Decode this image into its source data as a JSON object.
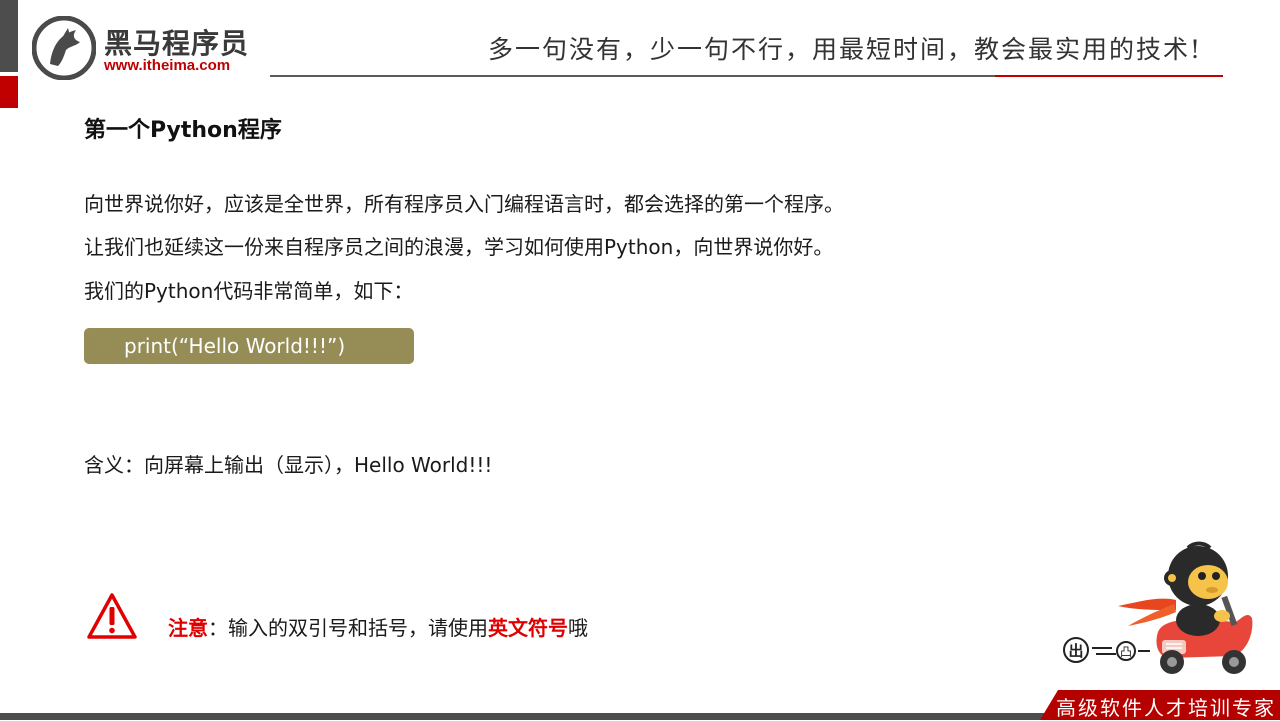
{
  "header": {
    "logo_name": "黑马程序员",
    "logo_url": "www.itheima.com",
    "slogan": "多一句没有，少一句不行，用最短时间，教会最实用的技术!"
  },
  "content": {
    "title": "第一个Python程序",
    "paragraphs": [
      "向世界说你好，应该是全世界，所有程序员入门编程语言时，都会选择的第一个程序。",
      "让我们也延续这一份来自程序员之间的浪漫，学习如何使用Python，向世界说你好。",
      "我们的Python代码非常简单，如下："
    ],
    "code": "print(“Hello World!!!”)",
    "meaning": "含义：向屏幕上输出（显示），Hello  World!!!"
  },
  "note": {
    "label": "注意",
    "text": "：输入的双引号和括号，请使用",
    "highlight": "英文符号",
    "suffix": "哦"
  },
  "mascot": {
    "sign": "出",
    "sign_two": "凸"
  },
  "footer": {
    "tagline": "高级软件人才培训专家"
  },
  "colors": {
    "brand_red": "#c00000",
    "code_bg": "#968d56",
    "dark_gray": "#4d4d4d"
  }
}
